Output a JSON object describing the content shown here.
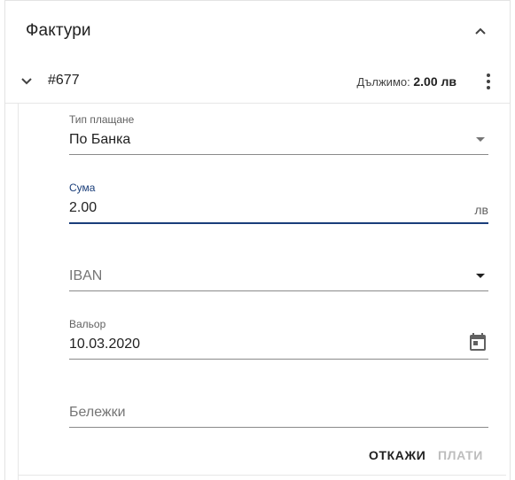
{
  "card": {
    "title": "Фактури",
    "collapse_icon": "chevron-up-icon"
  },
  "invoice": {
    "number": "#677",
    "due_label": "Дължимо:",
    "due_value": "2.00 лв",
    "expand_icon": "chevron-down-icon",
    "menu_icon": "more-vert-icon"
  },
  "form": {
    "payment_type": {
      "label": "Тип плащане",
      "value": "По Банка"
    },
    "amount": {
      "label": "Сума",
      "value": "2.00",
      "suffix": "лв"
    },
    "iban": {
      "placeholder": "IBAN"
    },
    "value_date": {
      "label": "Вальор",
      "value": "10.03.2020",
      "icon": "calendar-icon"
    },
    "notes": {
      "placeholder": "Бележки"
    }
  },
  "actions": {
    "cancel_label": "ОТКАЖИ",
    "pay_label": "ПЛАТИ"
  },
  "colors": {
    "accent": "#1a3e7a",
    "disabled": "#bdbdbd"
  }
}
